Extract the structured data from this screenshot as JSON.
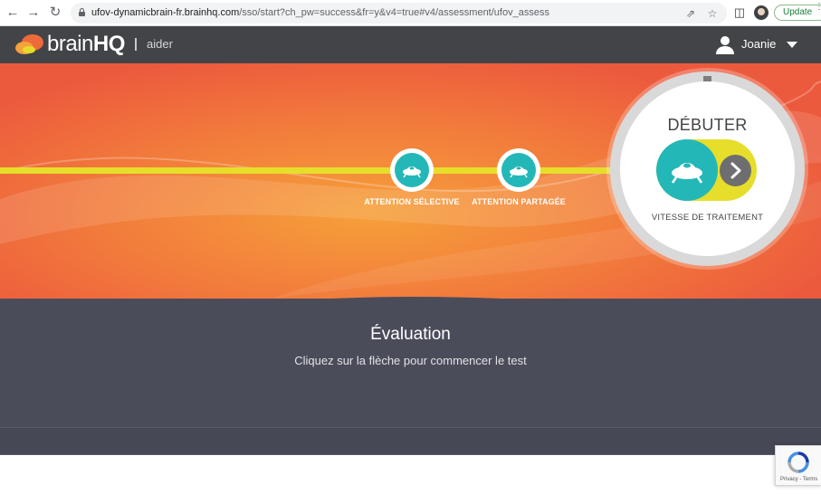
{
  "browser": {
    "url_host": "ufov-dynamicbrain-fr.brainhq.com",
    "url_path": "/sso/start?ch_pw=success&fr=y&v4=true#v4/assessment/ufov_assess",
    "update_label": "Update",
    "icons": [
      "back-arrow-icon",
      "forward-arrow-icon",
      "reload-icon",
      "lock-icon",
      "share-icon",
      "star-icon",
      "side-panel-icon",
      "profile-avatar",
      "more-icon"
    ]
  },
  "header": {
    "logo_text_light": "brain",
    "logo_text_bold": "HQ",
    "help_link": "aider",
    "user_name": "Joanie"
  },
  "assessment": {
    "steps": [
      {
        "label": "ATTENTION SÉLECTIVE"
      },
      {
        "label": "ATTENTION PARTAGÉE"
      }
    ],
    "current": {
      "title": "DÉBUTER",
      "subtitle": "VITESSE DE TRAITEMENT"
    }
  },
  "main": {
    "title": "Évaluation",
    "subtitle": "Cliquez sur la flèche pour commencer le test"
  },
  "recaptcha": {
    "text": "Privacy - Terms"
  },
  "colors": {
    "header_bg": "#434448",
    "hero_orange": "#ee6a3f",
    "track_yellow": "#e6de2a",
    "node_teal": "#24b7b8",
    "band_dark": "#4b4c5a"
  }
}
